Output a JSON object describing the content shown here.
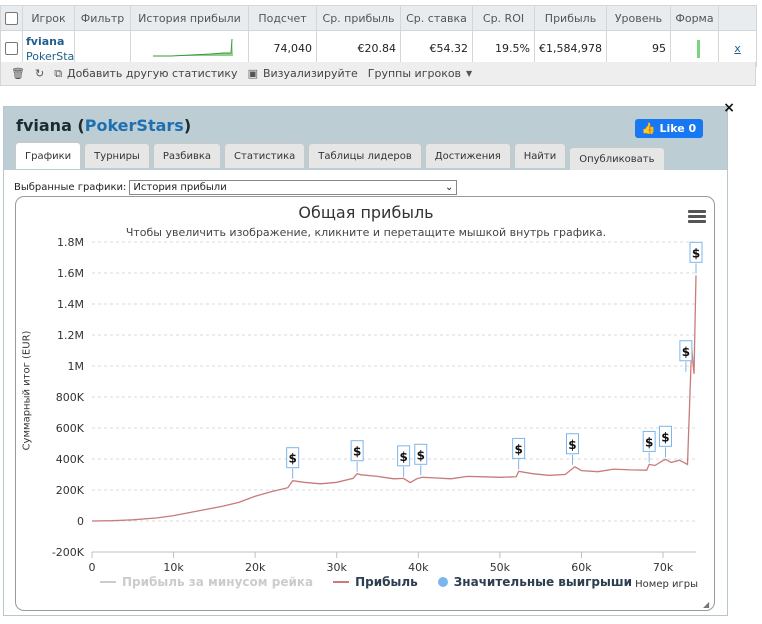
{
  "stats_table": {
    "headers": [
      "Игрок",
      "Фильтр",
      "История прибыли",
      "Подсчет",
      "Ср. прибыль",
      "Ср. ставка",
      "Ср. ROI",
      "Прибыль",
      "Уровень",
      "Форма"
    ],
    "row": {
      "player": "fviana",
      "site": "PokerSta",
      "count": "74,040",
      "avg_profit": "€20.84",
      "avg_stake": "€54.32",
      "avg_roi": "19.5%",
      "profit": "€1,584,978",
      "level": "95",
      "remove": "x"
    }
  },
  "toolbar": {
    "add_stat": "Добавить другую статистику",
    "visualize": "Визуализируйте",
    "groups": "Группы игроков"
  },
  "panel": {
    "player": "fviana",
    "site": "PokerStars",
    "like_label": "Like 0",
    "close": "×",
    "tabs": [
      "Графики",
      "Турниры",
      "Разбивка",
      "Статистика",
      "Таблицы лидеров",
      "Достижения",
      "Найти"
    ],
    "publish": "Опубликовать",
    "graph_select_label": "Выбранные графики:",
    "graph_select_value": "История прибыли"
  },
  "chart_data": {
    "type": "line",
    "title": "Общая прибыль",
    "subtitle": "Чтобы увеличить изображение, кликните и перетащите мышкой внутрь графика.",
    "xlabel": "Номер игры",
    "ylabel": "Суммарный итог (EUR)",
    "xlim": [
      0,
      74040
    ],
    "ylim": [
      -200000,
      1800000
    ],
    "x_ticks": [
      0,
      10000,
      20000,
      30000,
      40000,
      50000,
      60000,
      70000
    ],
    "x_tick_labels": [
      "0",
      "10k",
      "20k",
      "30k",
      "40k",
      "50k",
      "60k",
      "70k"
    ],
    "y_ticks": [
      -200000,
      0,
      200000,
      400000,
      600000,
      800000,
      1000000,
      1200000,
      1400000,
      1600000,
      1800000
    ],
    "y_tick_labels": [
      "-200K",
      "0",
      "200K",
      "400K",
      "600K",
      "800K",
      "1M",
      "1.2M",
      "1.4M",
      "1.6M",
      "1.8M"
    ],
    "grid": "horizontal dashed",
    "legend_position": "bottom",
    "series": [
      {
        "name": "Прибыль",
        "color": "#c97a7a",
        "x": [
          0,
          2500,
          5000,
          8000,
          10000,
          12000,
          14000,
          16000,
          18000,
          20000,
          22000,
          24000,
          24600,
          26000,
          28000,
          30000,
          32000,
          32500,
          33000,
          35000,
          37000,
          38200,
          39000,
          39800,
          40500,
          42000,
          44000,
          46000,
          48000,
          50000,
          52000,
          52300,
          54000,
          56000,
          58000,
          59200,
          60000,
          62000,
          64000,
          66000,
          68000,
          68300,
          69000,
          70000,
          70300,
          71000,
          72000,
          73000,
          73500,
          73800,
          74040
        ],
        "values": [
          0,
          2000,
          8000,
          20000,
          35000,
          55000,
          75000,
          95000,
          120000,
          160000,
          190000,
          215000,
          260000,
          250000,
          240000,
          250000,
          275000,
          305000,
          298000,
          288000,
          272000,
          275000,
          248000,
          272000,
          282000,
          278000,
          272000,
          288000,
          285000,
          282000,
          285000,
          320000,
          305000,
          295000,
          300000,
          350000,
          325000,
          318000,
          335000,
          330000,
          328000,
          365000,
          358000,
          390000,
          398000,
          378000,
          392000,
          365000,
          1120000,
          950000,
          1584978
        ]
      },
      {
        "name": "Прибыль за минусом рейка",
        "color": "#cccccc",
        "values": []
      },
      {
        "name": "Значительные выигрыши",
        "color": "#7cb5ec",
        "marker_label": "$",
        "x": [
          24600,
          32500,
          38200,
          40300,
          52300,
          58900,
          68300,
          70300,
          72800,
          74040
        ],
        "values": [
          260000,
          305000,
          272000,
          282000,
          320000,
          350000,
          365000,
          398000,
          950000,
          1584978
        ]
      }
    ]
  }
}
